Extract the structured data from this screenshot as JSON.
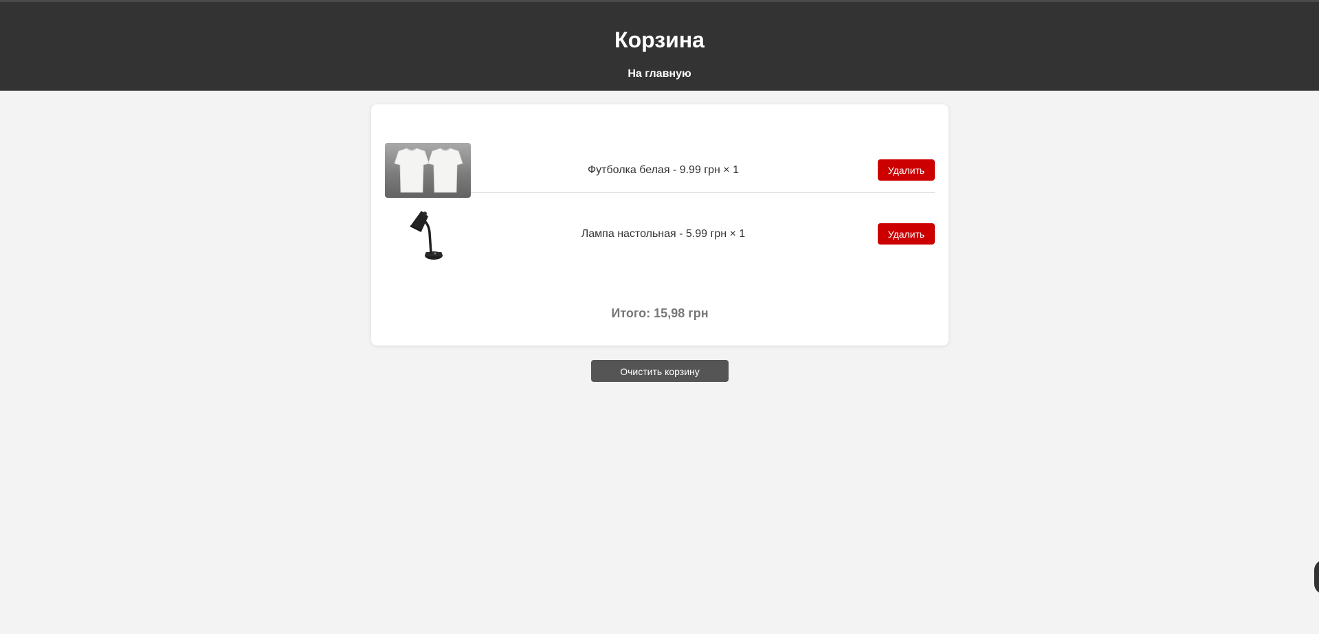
{
  "header": {
    "title": "Корзина",
    "home_link": "На главную"
  },
  "cart": {
    "items": [
      {
        "name": "Футболка белая",
        "price": "9.99",
        "currency": "грн",
        "quantity": "1",
        "text": "Футболка белая - 9.99 грн × 1",
        "image": "tshirt-image",
        "remove_label": "Удалить"
      },
      {
        "name": "Лампа настольная",
        "price": "5.99",
        "currency": "грн",
        "quantity": "1",
        "text": "Лампа настольная - 5.99 грн × 1",
        "image": "desk-lamp-image",
        "remove_label": "Удалить"
      }
    ],
    "total_label": "Итого:",
    "total_value": "15,98 грн"
  },
  "actions": {
    "clear_label": "Очистить корзину"
  },
  "colors": {
    "header_bg": "#333333",
    "page_bg": "#f3f3f3",
    "remove_button": "#cc0000",
    "clear_button": "#555555"
  }
}
